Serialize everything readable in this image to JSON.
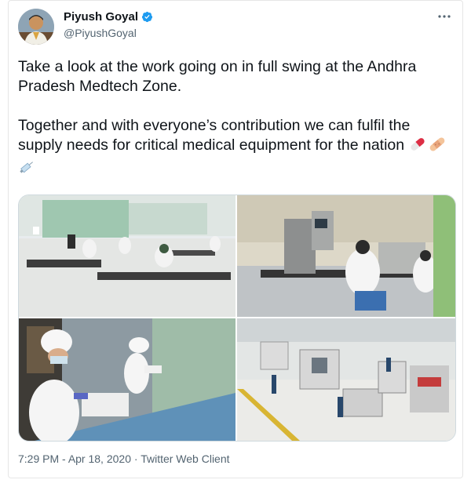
{
  "author": {
    "display_name": "Piyush Goyal",
    "handle": "@PiyushGoyal",
    "verified": true,
    "avatar_icon": "profile-photo"
  },
  "menu_icon": "more-options-icon",
  "tweet": {
    "paragraph1": "Take a look at the work going on in full swing at the Andhra Pradesh Medtech Zone.",
    "paragraph2": "Together and with everyone’s contribution we can fulfil the supply needs for critical medical equipment for the nation",
    "emojis": [
      "pill-emoji",
      "bandage-emoji",
      "syringe-emoji"
    ]
  },
  "media": {
    "photos": [
      "factory-floor-workstations-photo",
      "lab-machine-operators-photo",
      "workers-assembling-devices-photo",
      "cnc-machine-shop-photo"
    ]
  },
  "meta": {
    "time": "7:29 PM",
    "date": "Apr 18, 2020",
    "separator": "·",
    "client": "Twitter Web Client"
  },
  "colors": {
    "text": "#0f1419",
    "secondary": "#536471",
    "verified_blue": "#1d9bf0",
    "border": "#cfd9de"
  }
}
